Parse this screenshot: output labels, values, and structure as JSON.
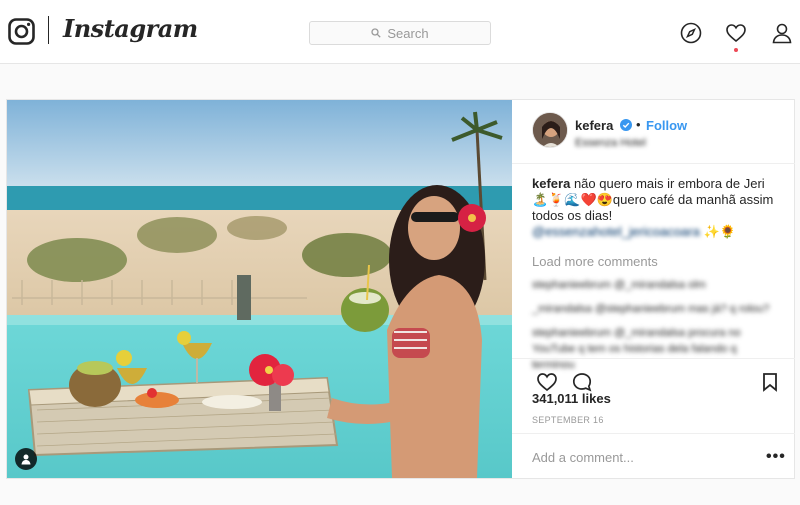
{
  "nav": {
    "wordmark": "Instagram",
    "search_placeholder": "Search",
    "icons": [
      "instagram-logo-icon",
      "search-icon",
      "compass-icon",
      "heart-icon",
      "profile-icon"
    ],
    "notification_color": "#ed4956"
  },
  "post": {
    "username": "kefera",
    "verified": true,
    "follow_label": "Follow",
    "follow_color": "#3897f0",
    "location": "Essenza Hotel",
    "caption": {
      "username": "kefera",
      "text": "não quero mais ir embora de Jeri 🏝️🍹🌊❤️😍quero café da manhã assim todos os dias!",
      "mention": "@essenzahotel_jericoacoara",
      "emoji_tail": "✨🌻"
    },
    "load_more": "Load more comments",
    "comments": [
      {
        "text": "stephanieebrum @_mirandalsa olm"
      },
      {
        "text": "_mirandalsa @stephanieebrum mas já? q rolou?"
      },
      {
        "text": "stephanieebrum @_mirandalsa procura no YouTube q tem os historias dela falando q terminou"
      }
    ],
    "likes": "341,011 likes",
    "date": "SEPTEMBER 16",
    "add_comment_placeholder": "Add a comment...",
    "more_options": "•••"
  }
}
